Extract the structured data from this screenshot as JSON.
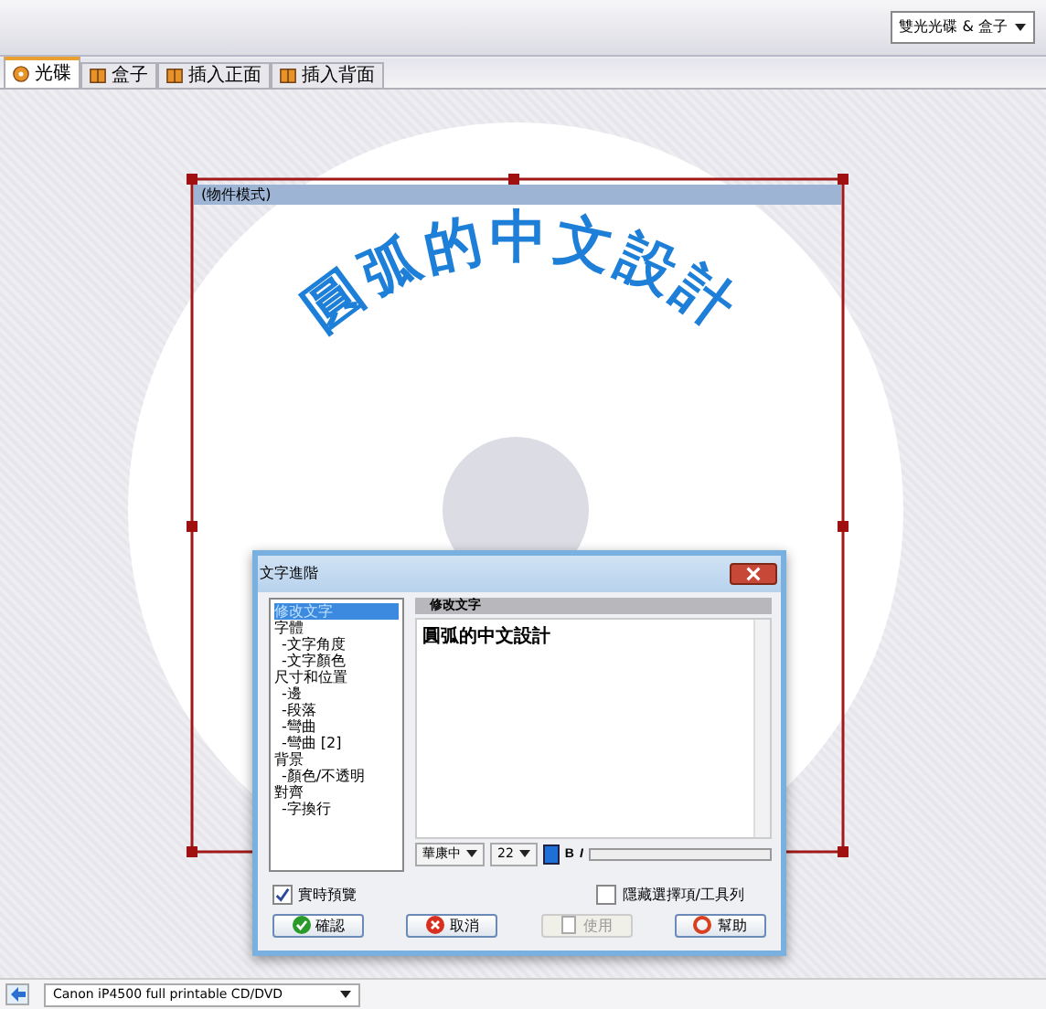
{
  "toolbar": {
    "layout_select": "雙光光碟 & 盒子"
  },
  "tabs": [
    {
      "label": "光碟",
      "kind": "disc",
      "selected": true
    },
    {
      "label": "盒子",
      "kind": "book",
      "selected": false
    },
    {
      "label": "插入正面",
      "kind": "book",
      "selected": false
    },
    {
      "label": "插入背面",
      "kind": "book",
      "selected": false
    }
  ],
  "canvas": {
    "mode_label": "(物件模式)",
    "arc_text": "圓弧的中文設計"
  },
  "dialog": {
    "title": "文字進階",
    "tree": [
      {
        "label": "修改文字",
        "selected": true
      },
      {
        "label": "字體",
        "selected": false,
        "children": [
          {
            "label": "-文字角度",
            "selected": false
          },
          {
            "label": "-文字顏色",
            "selected": false
          }
        ]
      },
      {
        "label": "尺寸和位置",
        "selected": false,
        "children": [
          {
            "label": "-邊",
            "selected": false
          },
          {
            "label": "-段落",
            "selected": false
          },
          {
            "label": "-彎曲",
            "selected": false
          },
          {
            "label": "-彎曲 [2]",
            "selected": false
          }
        ]
      },
      {
        "label": "背景",
        "selected": false,
        "children": [
          {
            "label": "-顏色/不透明",
            "selected": false
          }
        ]
      },
      {
        "label": "對齊",
        "selected": false,
        "children": [
          {
            "label": "-字換行",
            "selected": false
          }
        ]
      }
    ],
    "section_title": "修改文字",
    "text_value": "圓弧的中文設計",
    "font": "華康中",
    "size": "22",
    "bold_label": "B",
    "italic_label": "I",
    "slider": {
      "level": 1
    },
    "checkboxes": [
      {
        "label": "實時預覽",
        "checked": true
      },
      {
        "label": "隱藏選擇項/工具列",
        "checked": false
      }
    ],
    "buttons": [
      {
        "label": "確認",
        "kind": "ok",
        "disabled": false
      },
      {
        "label": "取消",
        "kind": "cancel",
        "disabled": false
      },
      {
        "label": "使用",
        "kind": "apply",
        "disabled": true
      },
      {
        "label": "幫助",
        "kind": "help",
        "disabled": false
      }
    ]
  },
  "status_bar": {
    "printer": "Canon iP4500 full printable CD/DVD"
  }
}
